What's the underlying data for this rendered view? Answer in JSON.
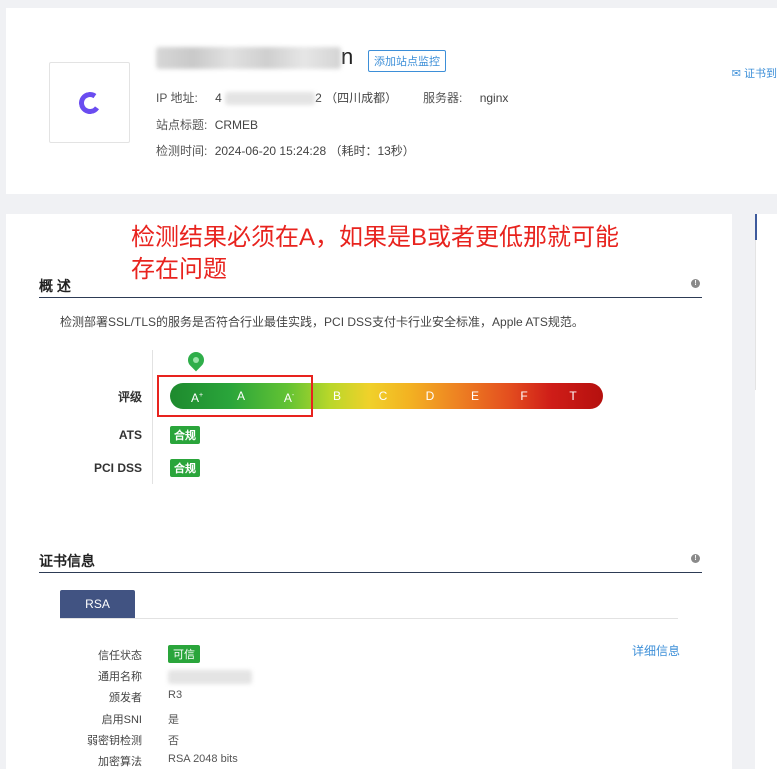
{
  "header": {
    "title_suffix": "n",
    "monitor_button": "添加站点监控",
    "ip_label": "IP 地址:",
    "ip_prefix": "4",
    "ip_suffix": "2  （四川成都）",
    "server_label": "服务器:",
    "server_value": "nginx",
    "site_title_label": "站点标题:",
    "site_title_value": "CRMEB",
    "check_time_label": "检测时间:",
    "check_time_value": "2024-06-20 15:24:28 （耗时：13秒）",
    "cert_side_link": "证书到"
  },
  "annotation": {
    "line1": "检测结果必须在A，如果是B或者更低那就可能",
    "line2": "存在问题"
  },
  "overview": {
    "title": "概 述",
    "description": "检测部署SSL/TLS的服务是否符合行业最佳实践，PCI DSS支付卡行业安全标准，Apple ATS规范。",
    "rating_label": "评级",
    "ats_label": "ATS",
    "ats_badge": "合规",
    "pci_label": "PCI DSS",
    "pci_badge": "合规",
    "grades": [
      "A",
      "A",
      "A",
      "B",
      "C",
      "D",
      "E",
      "F",
      "T"
    ],
    "grade_marks": [
      "+",
      "",
      "-",
      "",
      "",
      "",
      "",
      "",
      ""
    ],
    "current_grade": "A+"
  },
  "cert": {
    "title": "证书信息",
    "tab": "RSA",
    "detail_link": "详细信息",
    "fields": {
      "trust_status": "信任状态",
      "common_name": "通用名称",
      "issuer": "颁发者",
      "sni": "启用SNI",
      "weak_key": "弱密钥检测",
      "algorithm": "加密算法"
    },
    "values": {
      "trust_status": "可信",
      "issuer": "R3",
      "sni": "是",
      "weak_key": "否",
      "algorithm": "RSA 2048 bits"
    }
  },
  "colors": {
    "accent_blue": "#3d8fd8",
    "tab_blue": "#415382",
    "pass_green": "#2aa53b",
    "annotation_red": "#e8231e"
  }
}
